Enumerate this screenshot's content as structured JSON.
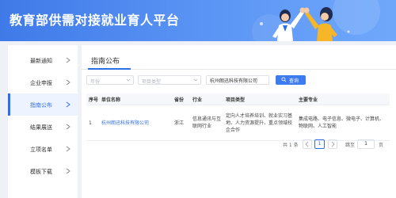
{
  "header": {
    "title": "教育部供需对接就业育人平台"
  },
  "sidebar": {
    "items": [
      {
        "label": "最新通知",
        "active": false
      },
      {
        "label": "企业申报",
        "active": false
      },
      {
        "label": "指南公布",
        "active": true
      },
      {
        "label": "结果展送",
        "active": false
      },
      {
        "label": "立项名单",
        "active": false
      },
      {
        "label": "模板下载",
        "active": false
      }
    ]
  },
  "main": {
    "title": "指南公布",
    "filters": {
      "year_placeholder": "年份",
      "type_placeholder": "项目类型",
      "search_value": "杭州朗迅科技有限公司",
      "search_label": "查询"
    },
    "table": {
      "headers": [
        "序号",
        "单位名称",
        "省份",
        "行业",
        "项目类型",
        "主要专业"
      ],
      "rows": [
        {
          "index": "1",
          "company": "杭州朗迅科技有限公司",
          "province": "浙江",
          "industry": "信息通讯与互联网行业",
          "project_type": "定向人才培养培训、就业实习基地、人力资源提升、重点领域校企合作",
          "majors": "集成电路、电子信息、微电子、计算机、物联网、人工智能"
        }
      ]
    },
    "pagination": {
      "total_text": "共 1 条",
      "current_page": "1",
      "jump_label": "跳至",
      "jump_value": "1",
      "page_unit": "页"
    }
  },
  "colors": {
    "primary": "#2f6fe6",
    "header_start": "#3f7ae8",
    "header_end": "#6fa8fb"
  }
}
